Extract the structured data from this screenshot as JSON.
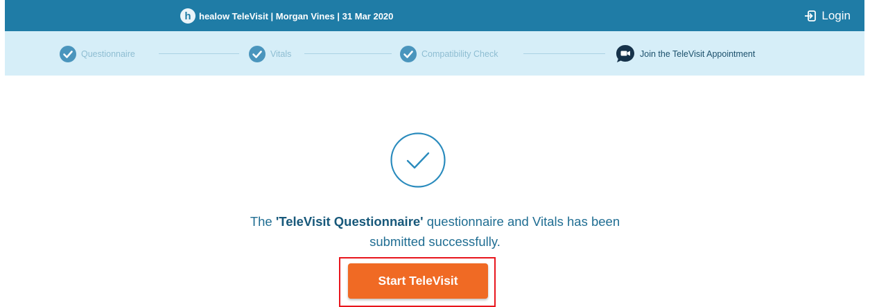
{
  "header": {
    "logo_letter": "h",
    "title": "healow TeleVisit | Morgan Vines | 31 Mar 2020",
    "login_label": "Login"
  },
  "steps": [
    {
      "label": "Questionnaire",
      "icon": "check-circle-icon",
      "completed": true
    },
    {
      "label": "Vitals",
      "icon": "check-circle-icon",
      "completed": true
    },
    {
      "label": "Compatibility Check",
      "icon": "check-circle-icon",
      "completed": true
    },
    {
      "label": "Join the TeleVisit Appointment",
      "icon": "video-chat-icon",
      "completed": false
    }
  ],
  "message": {
    "prefix": "The ",
    "questionnaire_name": "'TeleVisit Questionnaire'",
    "line1_suffix": " questionnaire and Vitals has been",
    "line2": "submitted successfully."
  },
  "action": {
    "start_label": "Start TeleVisit"
  },
  "colors": {
    "header_bg": "#1f7ca6",
    "steps_bg": "#d6eef8",
    "accent_button": "#f06a24",
    "highlight_outline": "#e8151c"
  }
}
